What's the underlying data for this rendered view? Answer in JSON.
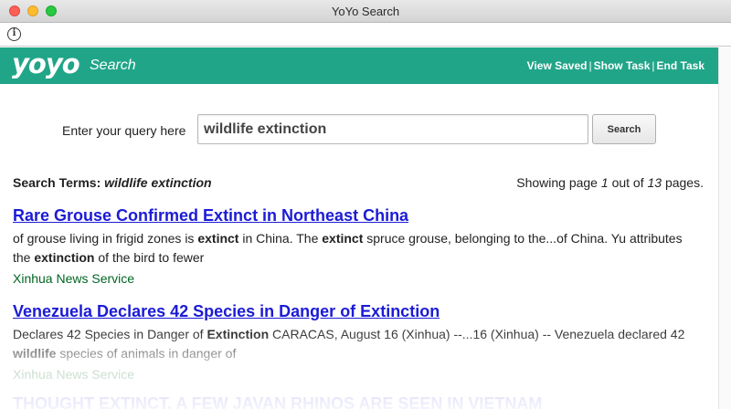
{
  "window": {
    "title": "YoYo Search"
  },
  "banner": {
    "logo": "yoyo",
    "logo_sub": "Search",
    "links": [
      "View Saved",
      "Show Task",
      "End Task"
    ]
  },
  "search": {
    "label": "Enter your query here",
    "value": "wildlife extinction",
    "button": "Search"
  },
  "summary": {
    "terms_label": "Search Terms:",
    "terms_value": "wildlife extinction",
    "paging_prefix": "Showing page",
    "current_page": "1",
    "paging_mid": "out of",
    "total_pages": "13",
    "paging_suffix": "pages."
  },
  "results": [
    {
      "title": "Rare Grouse Confirmed Extinct in Northeast China",
      "snippet_parts": [
        {
          "t": "of grouse living in frigid zones is ",
          "b": false
        },
        {
          "t": "extinct",
          "b": true
        },
        {
          "t": " in China. The ",
          "b": false
        },
        {
          "t": "extinct",
          "b": true
        },
        {
          "t": " spruce grouse, belonging to the...of China. Yu attributes the ",
          "b": false
        },
        {
          "t": "extinction",
          "b": true
        },
        {
          "t": " of the bird to fewer",
          "b": false
        }
      ],
      "source": "Xinhua News Service"
    },
    {
      "title": "Venezuela Declares 42 Species in Danger of Extinction",
      "snippet_parts": [
        {
          "t": "Declares 42 Species in Danger of ",
          "b": false
        },
        {
          "t": "Extinction",
          "b": true
        },
        {
          "t": " CARACAS, August 16 (Xinhua) --...16 (Xinhua) -- Venezuela declared 42 ",
          "b": false
        },
        {
          "t": "wildlife",
          "b": true
        },
        {
          "t": " species of animals in danger of",
          "b": false
        }
      ],
      "source": "Xinhua News Service"
    },
    {
      "title": "THOUGHT EXTINCT, A FEW JAVAN RHINOS ARE SEEN IN VIETNAM"
    }
  ]
}
